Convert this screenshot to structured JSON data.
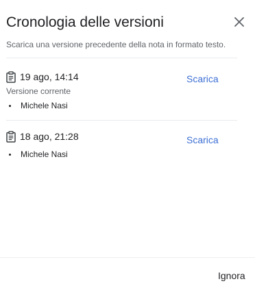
{
  "dialog": {
    "title": "Cronologia delle versioni",
    "subtitle": "Scarica una versione precedente della nota in formato testo.",
    "close_icon": "close-icon",
    "dismiss_label": "Ignora"
  },
  "versions": [
    {
      "date": "19 ago, 14:14",
      "status": "Versione corrente",
      "author": "Michele Nasi",
      "download_label": "Scarica",
      "icon": "clipboard-icon"
    },
    {
      "date": "18 ago, 21:28",
      "author": "Michele Nasi",
      "download_label": "Scarica",
      "icon": "clipboard-icon"
    }
  ],
  "colors": {
    "accent": "#3c6fd4",
    "text_primary": "#202124",
    "text_secondary": "#5f6368",
    "divider": "#e8eaed"
  }
}
